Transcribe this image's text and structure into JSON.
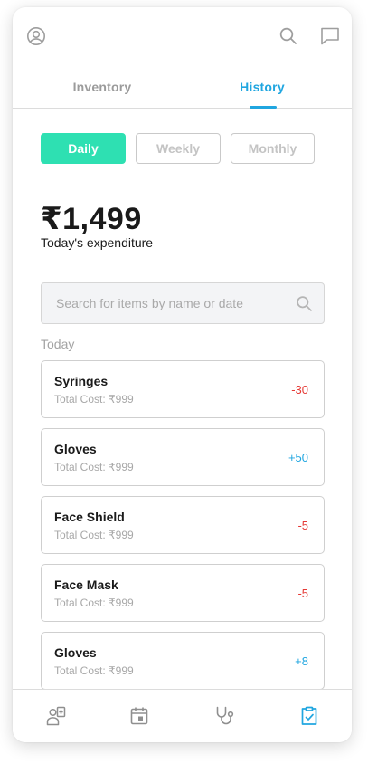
{
  "colors": {
    "accent": "#20a6e0",
    "daily_active": "#2ee0b2",
    "negative": "#e53935",
    "positive": "#20a6e0"
  },
  "tabs": [
    {
      "label": "Inventory",
      "active": false
    },
    {
      "label": "History",
      "active": true
    }
  ],
  "period_filter": {
    "daily": "Daily",
    "weekly": "Weekly",
    "monthly": "Monthly",
    "selected": "Daily"
  },
  "expenditure": {
    "amount": "₹1,499",
    "label": "Today's expenditure"
  },
  "search": {
    "placeholder": "Search for items by name or date"
  },
  "section": "Today",
  "items": [
    {
      "name": "Syringes",
      "cost": "Total Cost: ₹999",
      "change": "-30"
    },
    {
      "name": "Gloves",
      "cost": "Total Cost: ₹999",
      "change": "+50"
    },
    {
      "name": "Face Shield",
      "cost": "Total Cost: ₹999",
      "change": "-5"
    },
    {
      "name": "Face Mask",
      "cost": "Total Cost: ₹999",
      "change": "-5"
    },
    {
      "name": "Gloves",
      "cost": "Total Cost: ₹999",
      "change": "+8"
    }
  ],
  "icons": {
    "profile": "user-circle-icon",
    "search": "search-icon",
    "messages": "chat-icon",
    "nav": [
      "doctor-id-icon",
      "calendar-icon",
      "stethoscope-icon",
      "clipboard-check-icon"
    ],
    "active_nav": "clipboard-check-icon"
  }
}
